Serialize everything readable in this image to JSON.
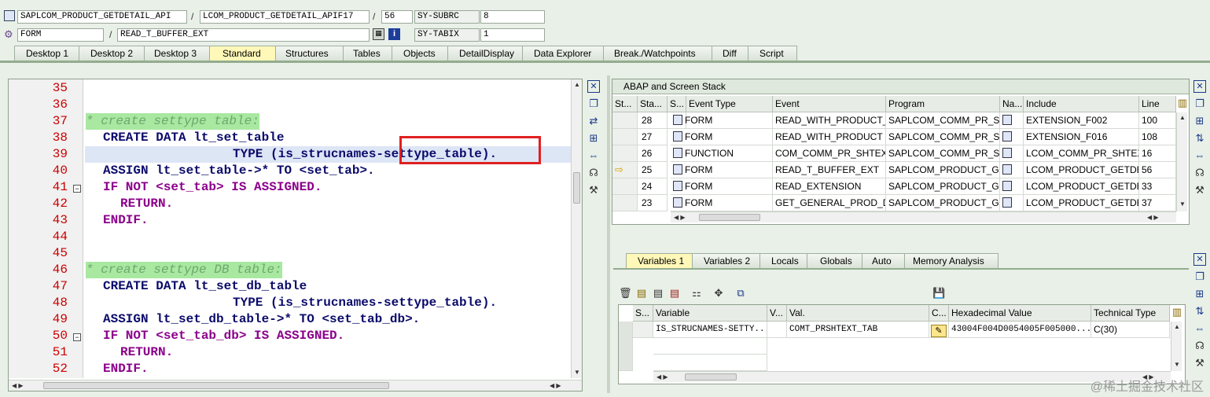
{
  "header": {
    "row1": {
      "program": "SAPLCOM_PRODUCT_GETDETAIL_API",
      "include": "LCOM_PRODUCT_GETDETAIL_APIF17",
      "line": "56",
      "sysvar": "SY-SUBRC",
      "sysval": "8"
    },
    "row2": {
      "type": "FORM",
      "event": "READ_T_BUFFER_EXT",
      "sysvar": "SY-TABIX",
      "sysval": "1"
    },
    "slash": "/"
  },
  "tabs": [
    "Desktop 1",
    "Desktop 2",
    "Desktop 3",
    "Standard",
    "Structures",
    "Tables",
    "Objects",
    "DetailDisplay",
    "Data Explorer",
    "Break./Watchpoints",
    "Diff",
    "Script"
  ],
  "editor": {
    "lines": [
      {
        "n": "35",
        "text": ""
      },
      {
        "n": "36",
        "text": ""
      },
      {
        "n": "37",
        "text": "* create settype table:"
      },
      {
        "n": "38",
        "text": "CREATE DATA lt_set_table"
      },
      {
        "n": "39",
        "text": "TYPE (is_strucnames-settype_table)."
      },
      {
        "n": "40",
        "text": "ASSIGN lt_set_table->* TO <set_tab>."
      },
      {
        "n": "41",
        "text": "IF NOT <set_tab> IS ASSIGNED."
      },
      {
        "n": "42",
        "text": "RETURN."
      },
      {
        "n": "43",
        "text": "ENDIF."
      },
      {
        "n": "44",
        "text": ""
      },
      {
        "n": "45",
        "text": ""
      },
      {
        "n": "46",
        "text": "* create settype DB table:"
      },
      {
        "n": "47",
        "text": "CREATE DATA lt_set_db_table"
      },
      {
        "n": "48",
        "text": "TYPE (is_strucnames-settype_table)."
      },
      {
        "n": "49",
        "text": "ASSIGN lt_set_db_table->* TO <set_tab_db>."
      },
      {
        "n": "50",
        "text": "IF NOT <set_tab_db> IS ASSIGNED."
      },
      {
        "n": "51",
        "text": "RETURN."
      },
      {
        "n": "52",
        "text": "ENDIF."
      }
    ]
  },
  "stack": {
    "title": "ABAP and Screen Stack",
    "columns": [
      "St...",
      "Sta...",
      "S...",
      "Event Type",
      "Event",
      "Program",
      "Na...",
      "Include",
      "Line"
    ],
    "rows": [
      {
        "level": "28",
        "type": "FORM",
        "event": "READ_WITH_PRODUCT_...",
        "program": "SAPLCOM_COMM_PR_SH...",
        "include": "EXTENSION_F002",
        "line": "100"
      },
      {
        "level": "27",
        "type": "FORM",
        "event": "READ_WITH_PRODUCT",
        "program": "SAPLCOM_COMM_PR_SH...",
        "include": "EXTENSION_F016",
        "line": "108"
      },
      {
        "level": "26",
        "type": "FUNCTION",
        "event": "COM_COMM_PR_SHTEX...",
        "program": "SAPLCOM_COMM_PR_SH...",
        "include": "LCOM_COMM_PR_SHTEX...",
        "line": "16"
      },
      {
        "level": "25",
        "type": "FORM",
        "event": "READ_T_BUFFER_EXT",
        "program": "SAPLCOM_PRODUCT_GE...",
        "include": "LCOM_PRODUCT_GETDE...",
        "line": "56"
      },
      {
        "level": "24",
        "type": "FORM",
        "event": "READ_EXTENSION",
        "program": "SAPLCOM_PRODUCT_GE...",
        "include": "LCOM_PRODUCT_GETDE...",
        "line": "33"
      },
      {
        "level": "23",
        "type": "FORM",
        "event": "GET_GENERAL_PROD_D...",
        "program": "SAPLCOM_PRODUCT_GE...",
        "include": "LCOM_PRODUCT_GETDE...",
        "line": "37"
      }
    ]
  },
  "vars": {
    "tabs": [
      "Variables 1",
      "Variables 2",
      "Locals",
      "Globals",
      "Auto",
      "Memory Analysis"
    ],
    "columns": [
      "S...",
      "Variable",
      "V...",
      "Val.",
      "C...",
      "Hexadecimal Value",
      "Technical Type"
    ],
    "row": {
      "variable": "IS_STRUCNAMES-SETTY...",
      "value": "COMT_PRSHTEXT_TAB",
      "hex": "43004F004D0054005F005000...",
      "type": "C(30)"
    }
  },
  "watermark": "@稀土掘金技术社区",
  "colors": {
    "highlight": "#dde6f5",
    "redbox": "#e02020",
    "activeTab": "#fff8b8",
    "lineNumber": "#cc0000"
  }
}
